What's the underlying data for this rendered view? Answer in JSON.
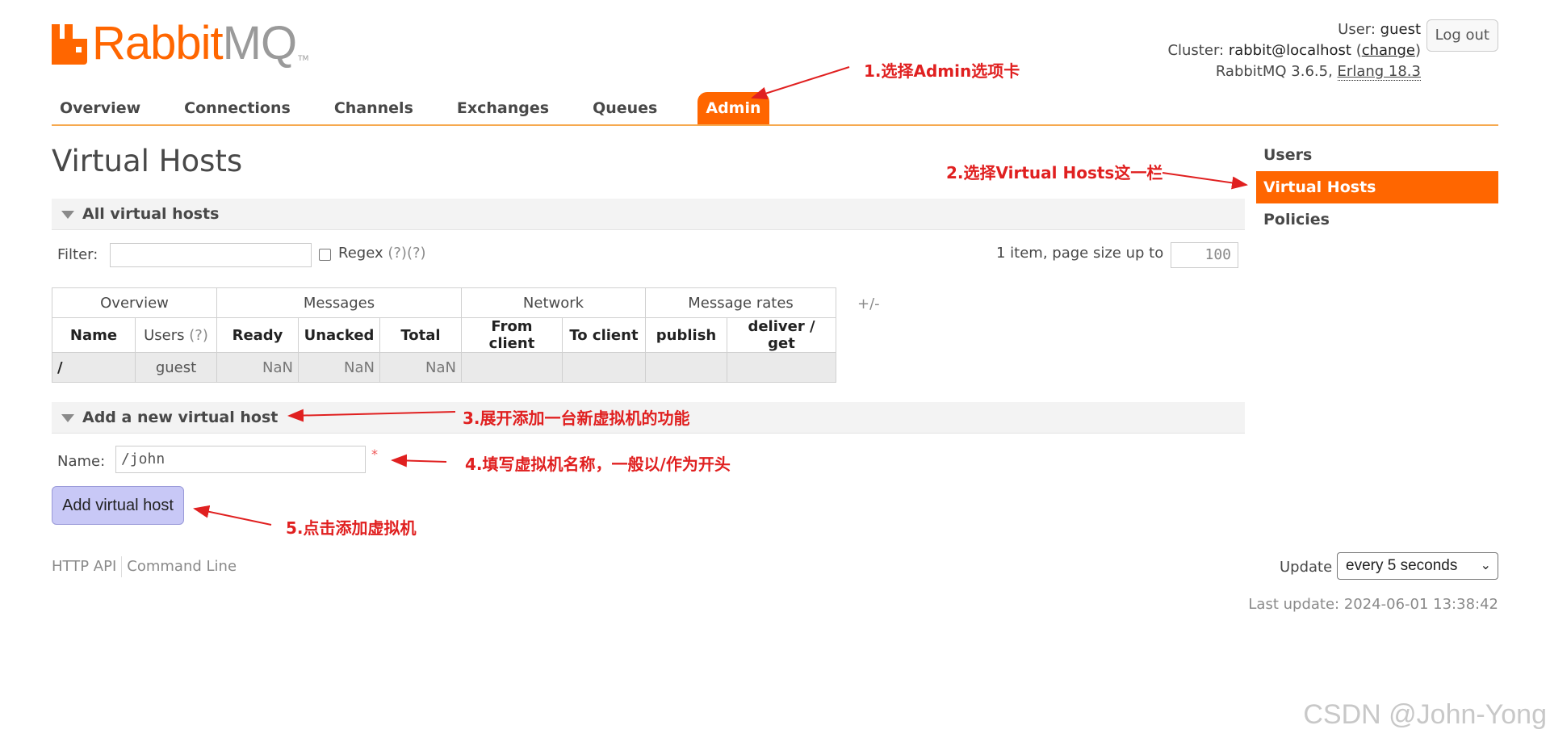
{
  "brand": {
    "name_part1": "Rabbit",
    "name_part2": "MQ",
    "tm": "TM"
  },
  "login": {
    "user_label": "User:",
    "user": "guest",
    "cluster_label": "Cluster:",
    "cluster": "rabbit@localhost",
    "change": "change",
    "version": "RabbitMQ 3.6.5,",
    "erlang": "Erlang 18.3",
    "logout": "Log out"
  },
  "tabs": [
    "Overview",
    "Connections",
    "Channels",
    "Exchanges",
    "Queues",
    "Admin"
  ],
  "page_title": "Virtual Hosts",
  "sidebar": [
    "Users",
    "Virtual Hosts",
    "Policies"
  ],
  "all_vhosts": {
    "title": "All virtual hosts",
    "filter_label": "Filter:",
    "regex_label": "Regex",
    "regex_help": "(?)(?)",
    "paging_text": "1 item, page size up to",
    "page_size": "100",
    "plusminus": "+/-",
    "groups": [
      "Overview",
      "Messages",
      "Network",
      "Message rates"
    ],
    "columns": [
      "Name",
      "Users",
      "Ready",
      "Unacked",
      "Total",
      "From client",
      "To client",
      "publish",
      "deliver / get"
    ],
    "users_help": "(?)",
    "rows": [
      {
        "name": "/",
        "users": "guest",
        "ready": "NaN",
        "unacked": "NaN",
        "total": "NaN",
        "from_client": "",
        "to_client": "",
        "publish": "",
        "deliver_get": ""
      }
    ]
  },
  "add_vhost": {
    "title": "Add a new virtual host",
    "name_label": "Name:",
    "name_value": "/john",
    "required": "*",
    "button": "Add virtual host"
  },
  "footer": {
    "http_api": "HTTP API",
    "command_line": "Command Line",
    "update_label": "Update",
    "update_value": "every 5 seconds",
    "last_update": "Last update: 2024-06-01 13:38:42"
  },
  "annotations": [
    "1.选择Admin选项卡",
    "2.选择Virtual Hosts这一栏",
    "3.展开添加一台新虚拟机的功能",
    "4.填写虚拟机名称，一般以/作为开头",
    "5.点击添加虚拟机"
  ],
  "watermark": "CSDN @John-Yong",
  "colors": {
    "accent": "#ff6600",
    "annotation": "#e02020",
    "button": "#c8c8f6"
  }
}
